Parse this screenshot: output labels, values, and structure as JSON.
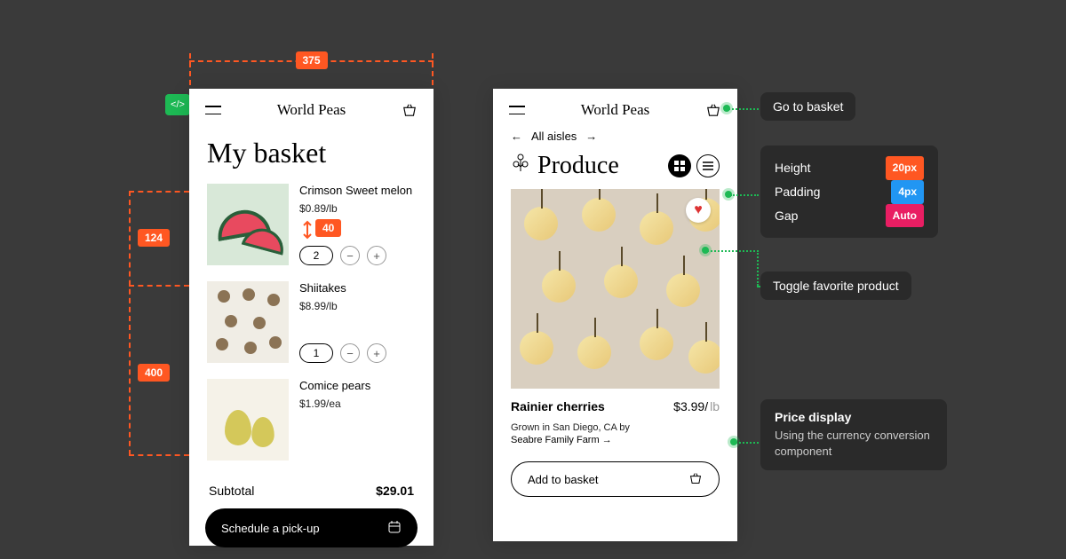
{
  "brand": "World Peas",
  "basket": {
    "title": "My basket",
    "items": [
      {
        "name": "Crimson Sweet melon",
        "price": "$0.89/lb",
        "qty": "2"
      },
      {
        "name": "Shiitakes",
        "price": "$8.99/lb",
        "qty": "1"
      },
      {
        "name": "Comice pears",
        "price": "$1.99/ea",
        "qty": ""
      }
    ],
    "subtotal_label": "Subtotal",
    "subtotal_value": "$29.01",
    "cta": "Schedule a pick-up"
  },
  "produce": {
    "crumb": "All aisles",
    "title": "Produce",
    "product_name": "Rainier cherries",
    "product_price": "$3.99/",
    "product_price_unit": "lb",
    "grown": "Grown in San Diego, CA by",
    "farm": "Seabre Family Farm →",
    "add_btn": "Add to basket"
  },
  "annotations": {
    "width": "375",
    "row_h": "124",
    "list_h": "400",
    "qty_badge": "40",
    "go_basket": "Go to basket",
    "toggle_fav": "Toggle favorite product",
    "price_title": "Price display",
    "price_desc": "Using the currency conversion component",
    "spec_height_label": "Height",
    "spec_height_val": "20px",
    "spec_padding_label": "Padding",
    "spec_padding_val": "4px",
    "spec_gap_label": "Gap",
    "spec_gap_val": "Auto"
  }
}
